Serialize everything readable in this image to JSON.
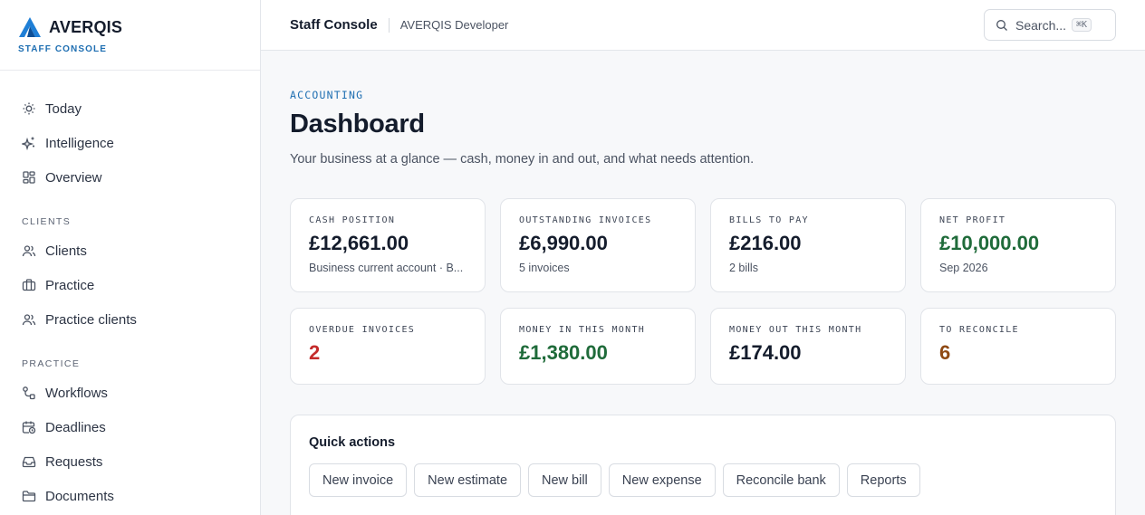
{
  "brand": {
    "name": "AVERQIS",
    "subtitle": "STAFF CONSOLE"
  },
  "sidebar": {
    "items_top": [
      {
        "label": "Today",
        "icon": "sun-icon"
      },
      {
        "label": "Intelligence",
        "icon": "sparkles-icon"
      },
      {
        "label": "Overview",
        "icon": "grid-icon"
      }
    ],
    "section_clients": "CLIENTS",
    "items_clients": [
      {
        "label": "Clients",
        "icon": "users-icon"
      },
      {
        "label": "Practice",
        "icon": "briefcase-icon"
      },
      {
        "label": "Practice clients",
        "icon": "users-icon"
      }
    ],
    "section_practice": "PRACTICE",
    "items_practice": [
      {
        "label": "Workflows",
        "icon": "workflow-icon"
      },
      {
        "label": "Deadlines",
        "icon": "calendar-clock-icon"
      },
      {
        "label": "Requests",
        "icon": "inbox-icon"
      },
      {
        "label": "Documents",
        "icon": "folder-icon"
      }
    ]
  },
  "topbar": {
    "title": "Staff Console",
    "user": "AVERQIS Developer",
    "search_placeholder": "Search...",
    "search_shortcut": "⌘K"
  },
  "page": {
    "eyebrow": "ACCOUNTING",
    "title": "Dashboard",
    "subtitle": "Your business at a glance — cash, money in and out, and what needs attention."
  },
  "cards": [
    {
      "label": "CASH POSITION",
      "value": "£12,661.00",
      "sub": "Business current account · B..."
    },
    {
      "label": "OUTSTANDING INVOICES",
      "value": "£6,990.00",
      "sub": "5 invoices"
    },
    {
      "label": "BILLS TO PAY",
      "value": "£216.00",
      "sub": "2 bills"
    },
    {
      "label": "NET PROFIT",
      "value": "£10,000.00",
      "sub": "Sep 2026"
    },
    {
      "label": "OVERDUE INVOICES",
      "value": "2"
    },
    {
      "label": "MONEY IN THIS MONTH",
      "value": "£1,380.00"
    },
    {
      "label": "MONEY OUT THIS MONTH",
      "value": "£174.00"
    },
    {
      "label": "TO RECONCILE",
      "value": "6"
    }
  ],
  "quick_actions": {
    "title": "Quick actions",
    "buttons": [
      "New invoice",
      "New estimate",
      "New bill",
      "New expense",
      "Reconcile bank",
      "Reports"
    ]
  },
  "colors": {
    "accent": "#1f6fb2",
    "positive": "#1f6b3a",
    "negative": "#c42b2b",
    "warning": "#8f4a14"
  }
}
